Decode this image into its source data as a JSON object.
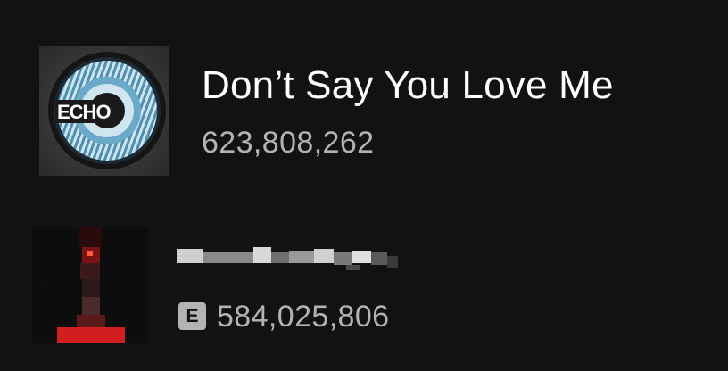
{
  "tracks": [
    {
      "title": "Don’t Say You Love Me",
      "plays": "623,808,262",
      "explicit": false,
      "artwork": {
        "label": "ECHO",
        "colors": {
          "ring": "#6aa9c8",
          "band": "#cfe6f0",
          "rim": "#151515"
        }
      }
    },
    {
      "title_pixelated": true,
      "plays": "584,025,806",
      "explicit": true,
      "explicit_label": "E",
      "artwork": {
        "colors": {
          "background": "#0d0d0d",
          "accent": "#d11f1f"
        }
      }
    }
  ],
  "colors": {
    "background": "#121212",
    "title_text": "#ffffff",
    "secondary_text": "#b3b3b3"
  }
}
